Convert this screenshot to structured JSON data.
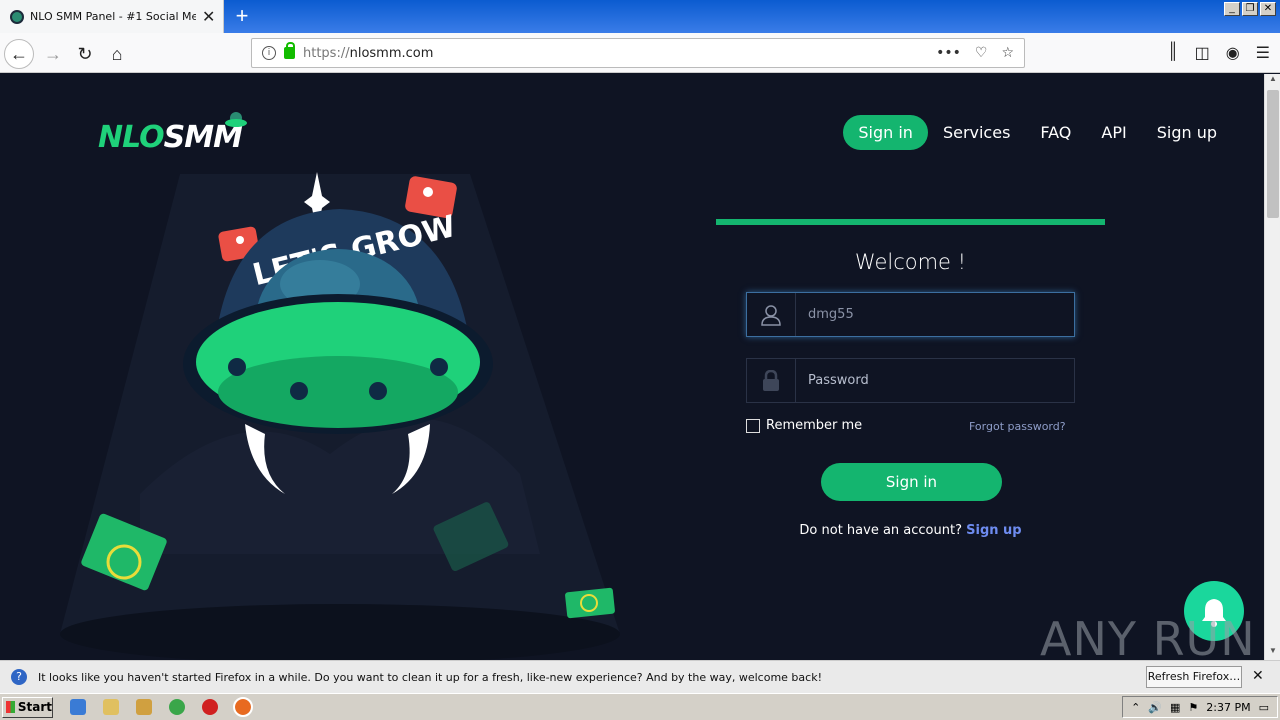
{
  "browser": {
    "tab_title": "NLO SMM Panel - #1 Social Media Panel",
    "tab_close": "✕",
    "new_tab": "+",
    "url_protocol": "https://",
    "url_host": "nlosmm.com",
    "url_more": "•••"
  },
  "site": {
    "logo_left": "NLO",
    "logo_right": "SMM",
    "nav": {
      "signin": "Sign in",
      "services": "Services",
      "faq": "FAQ",
      "api": "API",
      "signup": "Sign up"
    },
    "hero_text": "LET'S GROW"
  },
  "login": {
    "welcome": "Welcome !",
    "username_value": "dmg55",
    "password_placeholder": "Password",
    "remember": "Remember me",
    "forgot": "Forgot password?",
    "submit": "Sign in",
    "no_account": "Do not have an account?",
    "signup_link": "Sign up"
  },
  "watermark": "ANY RUN",
  "notification": {
    "message": "It looks like you haven't started Firefox in a while. Do you want to clean it up for a fresh, like-new experience? And by the way, welcome back!",
    "button": "Refresh Firefox…",
    "close": "✕"
  },
  "taskbar": {
    "start": "Start",
    "clock": "2:37 PM"
  },
  "colors": {
    "accent_green": "#14b56f",
    "page_bg": "#0f1423",
    "link_blue": "#6e8cf0"
  }
}
